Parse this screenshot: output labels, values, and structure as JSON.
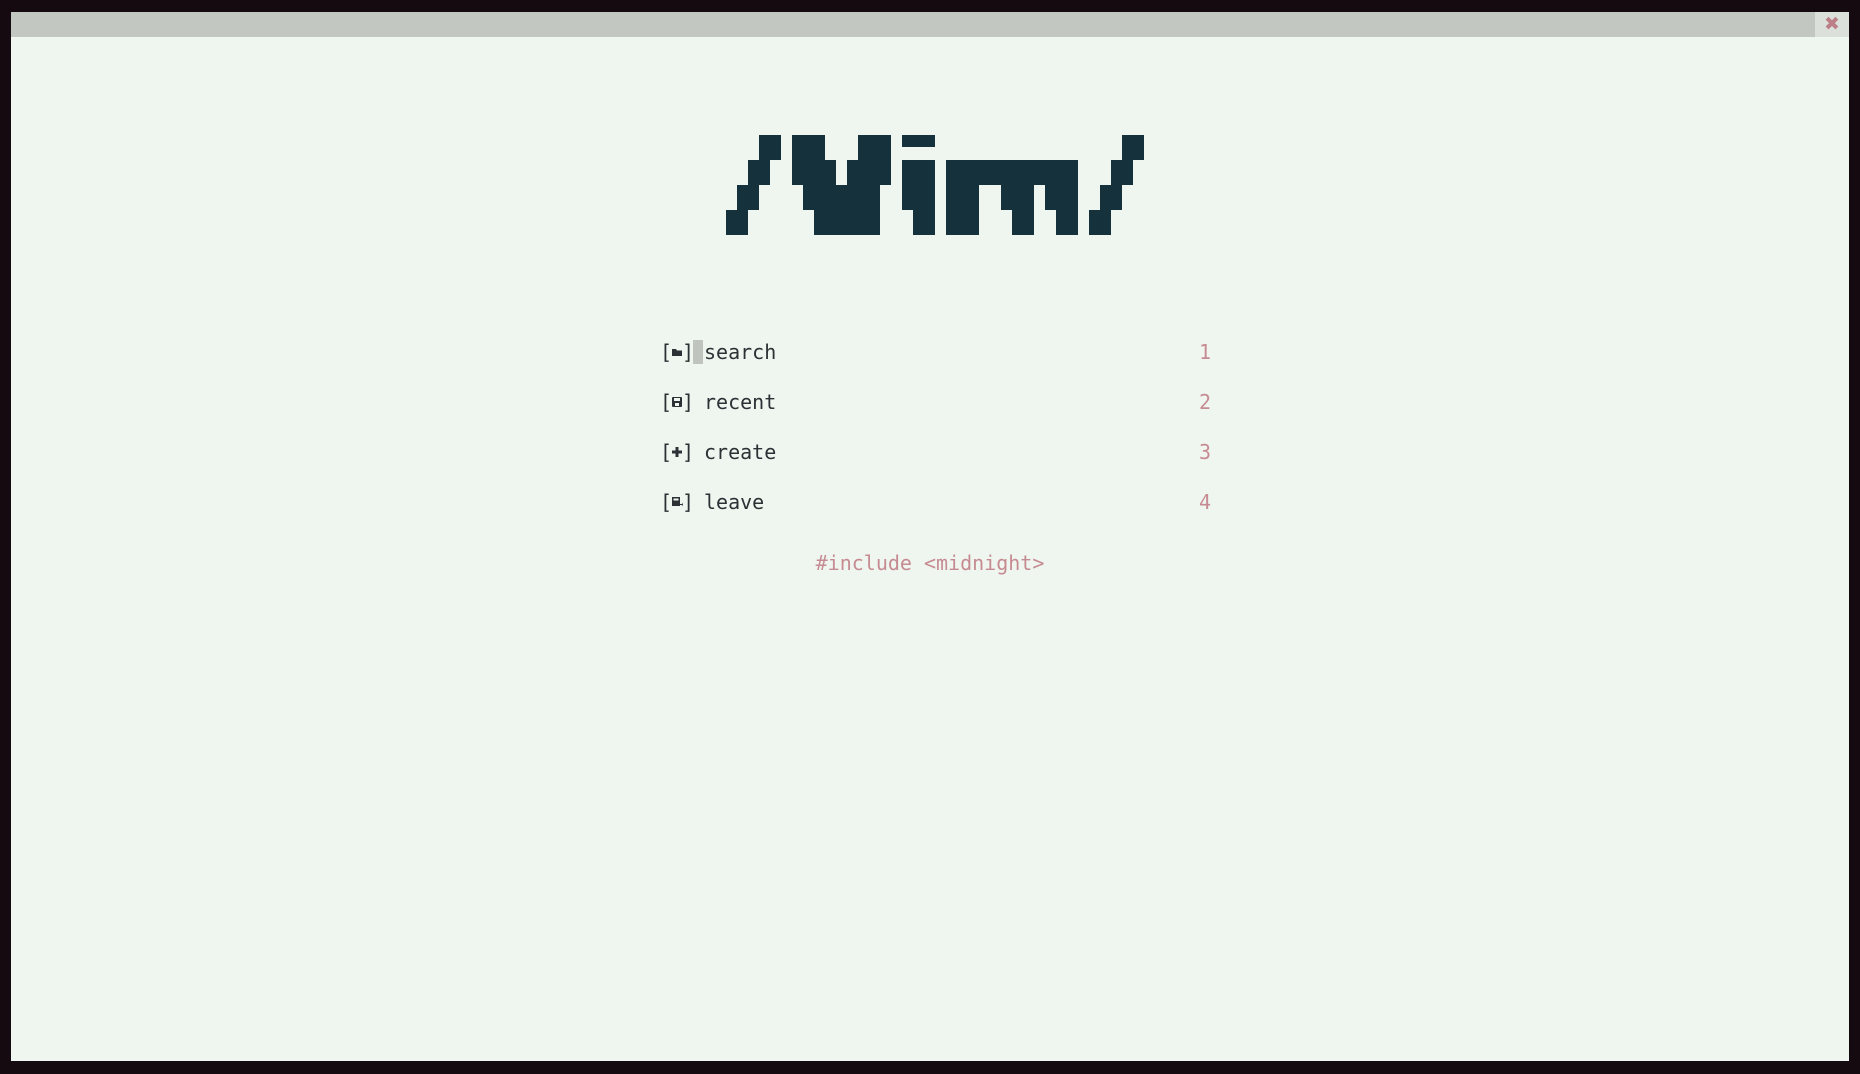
{
  "window": {
    "close_icon": "close-icon"
  },
  "logo": {
    "text": "/Vim/",
    "color": "#15313b"
  },
  "menu": [
    {
      "icon": "folder-icon",
      "label": "search",
      "key": "1"
    },
    {
      "icon": "floppy-disk-icon",
      "label": "recent",
      "key": "2"
    },
    {
      "icon": "plus-icon",
      "label": "create",
      "key": "3"
    },
    {
      "icon": "exit-icon",
      "label": "leave",
      "key": "4"
    }
  ],
  "footer": {
    "text": "#include <midnight>"
  },
  "colors": {
    "background": "#eff6ef",
    "frame": "#140a10",
    "titlebar": "#c2c7c1",
    "text": "#2b3134",
    "accent": "#c68b92"
  }
}
